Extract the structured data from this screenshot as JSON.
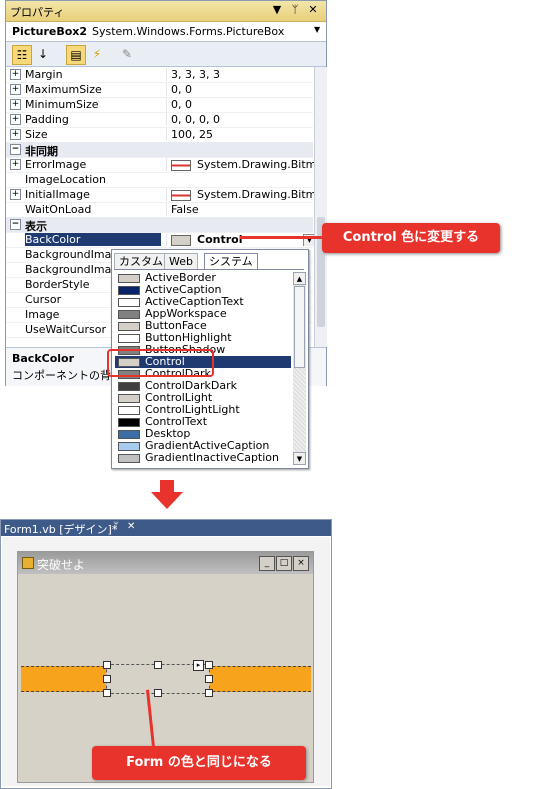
{
  "properties_panel": {
    "title": "プロパティ",
    "title_buttons": [
      "▼",
      "ᛘ",
      "✕"
    ],
    "object_name": "PictureBox2",
    "object_type": "System.Windows.Forms.PictureBox",
    "rows": [
      {
        "kind": "prop",
        "expand": "+",
        "name": "Margin",
        "value": "3, 3, 3, 3"
      },
      {
        "kind": "prop",
        "expand": "+",
        "name": "MaximumSize",
        "value": "0, 0"
      },
      {
        "kind": "prop",
        "expand": "+",
        "name": "MinimumSize",
        "value": "0, 0"
      },
      {
        "kind": "prop",
        "expand": "+",
        "name": "Padding",
        "value": "0, 0, 0, 0"
      },
      {
        "kind": "prop",
        "expand": "+",
        "name": "Size",
        "value": "100, 25"
      },
      {
        "kind": "category",
        "expand": "−",
        "name": "非同期",
        "value": ""
      },
      {
        "kind": "prop",
        "expand": "+",
        "name": "ErrorImage",
        "value": "System.Drawing.Bitmap"
      },
      {
        "kind": "prop",
        "expand": "",
        "name": "ImageLocation",
        "value": ""
      },
      {
        "kind": "prop",
        "expand": "+",
        "name": "InitialImage",
        "value": "System.Drawing.Bitmap"
      },
      {
        "kind": "prop",
        "expand": "",
        "name": "WaitOnLoad",
        "value": "False"
      },
      {
        "kind": "category",
        "expand": "−",
        "name": "表示",
        "value": ""
      },
      {
        "kind": "prop",
        "expand": "",
        "name": "BackColor",
        "value": "Control"
      },
      {
        "kind": "prop",
        "expand": "",
        "name": "BackgroundImage",
        "value": ""
      },
      {
        "kind": "prop",
        "expand": "",
        "name": "BackgroundImage",
        "value": ""
      },
      {
        "kind": "prop",
        "expand": "",
        "name": "BorderStyle",
        "value": ""
      },
      {
        "kind": "prop",
        "expand": "",
        "name": "Cursor",
        "value": ""
      },
      {
        "kind": "prop",
        "expand": "",
        "name": "Image",
        "value": ""
      },
      {
        "kind": "prop",
        "expand": "",
        "name": "UseWaitCursor",
        "value": ""
      }
    ],
    "description_title": "BackColor",
    "description_text": "コンポーネントの背景"
  },
  "color_dropdown": {
    "tabs": [
      "カスタム",
      "Web",
      "システム"
    ],
    "active_tab": "システム",
    "items": [
      {
        "name": "ActiveBorder",
        "color": "#d4d0c8"
      },
      {
        "name": "ActiveCaption",
        "color": "#0a246a"
      },
      {
        "name": "ActiveCaptionText",
        "color": "#ffffff"
      },
      {
        "name": "AppWorkspace",
        "color": "#808080"
      },
      {
        "name": "ButtonFace",
        "color": "#d4d0c8"
      },
      {
        "name": "ButtonHighlight",
        "color": "#ffffff"
      },
      {
        "name": "ButtonShadow",
        "color": "#808080"
      },
      {
        "name": "Control",
        "color": "#d4d0c8"
      },
      {
        "name": "ControlDark",
        "color": "#808080"
      },
      {
        "name": "ControlDarkDark",
        "color": "#404040"
      },
      {
        "name": "ControlLight",
        "color": "#d4d0c8"
      },
      {
        "name": "ControlLightLight",
        "color": "#ffffff"
      },
      {
        "name": "ControlText",
        "color": "#000000"
      },
      {
        "name": "Desktop",
        "color": "#3a6ea5"
      },
      {
        "name": "GradientActiveCaption",
        "color": "#a6caf0"
      },
      {
        "name": "GradientInactiveCaption",
        "color": "#c0c0c0"
      }
    ],
    "selected": "Control"
  },
  "callouts": {
    "top": "Control 色に変更する",
    "bottom": "Form の色と同じになる"
  },
  "designer": {
    "tab_title": "Form1.vb [デザイン]*",
    "tab_pin": "ᛘ",
    "tab_close": "✕",
    "form_title": "突破せよ",
    "form_buttons": [
      "_",
      "□",
      "×"
    ]
  },
  "colors": {
    "highlight_red": "#e8322c",
    "orange_band": "#f7a31b",
    "selection_blue": "#1f3a70"
  }
}
